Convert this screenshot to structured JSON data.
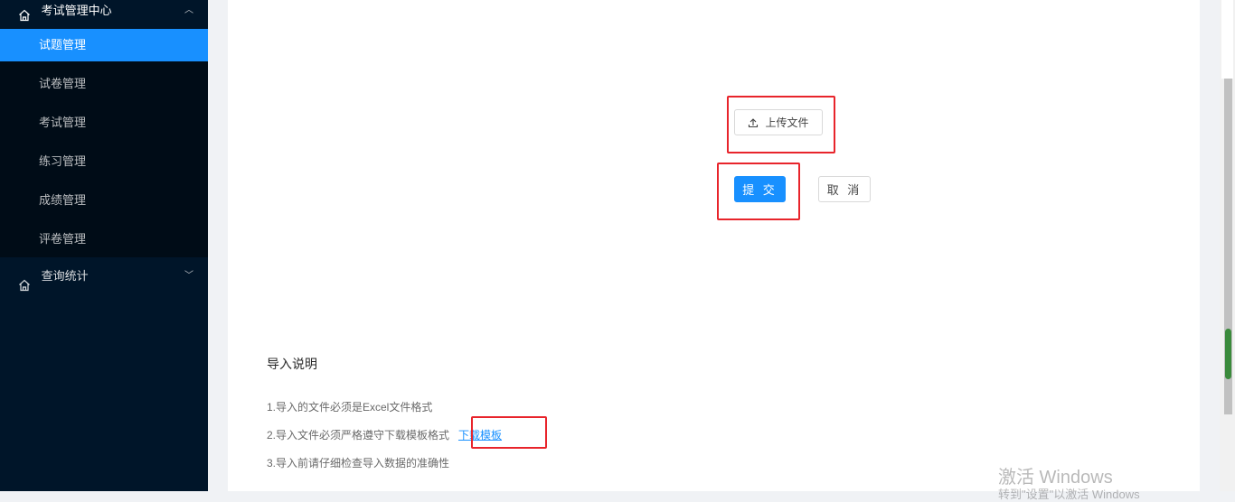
{
  "sidebar": {
    "group1": {
      "label": "考试管理中心",
      "arrow": "︿"
    },
    "items": [
      {
        "label": "试题管理"
      },
      {
        "label": "试卷管理"
      },
      {
        "label": "考试管理"
      },
      {
        "label": "练习管理"
      },
      {
        "label": "成绩管理"
      },
      {
        "label": "评卷管理"
      }
    ],
    "active_index": 0,
    "group2": {
      "label": "查询统计",
      "arrow": "﹀"
    }
  },
  "upload": {
    "label": "上传文件",
    "icon": "upload-icon"
  },
  "actions": {
    "submit_label": "提 交",
    "cancel_label": "取 消"
  },
  "instructions": {
    "title": "导入说明",
    "notes": [
      "1.导入的文件必须是Excel文件格式",
      "2.导入文件必须严格遵守下载模板格式",
      "3.导入前请仔细检查导入数据的准确性"
    ],
    "download_link": "下载模板"
  },
  "watermark": {
    "title": "激活 Windows",
    "subtitle": "转到\"设置\"以激活 Windows"
  },
  "colors": {
    "sidebar_bg": "#001529",
    "submenu_bg": "#000c17",
    "accent": "#1890ff",
    "highlight_box": "#e8242b"
  }
}
